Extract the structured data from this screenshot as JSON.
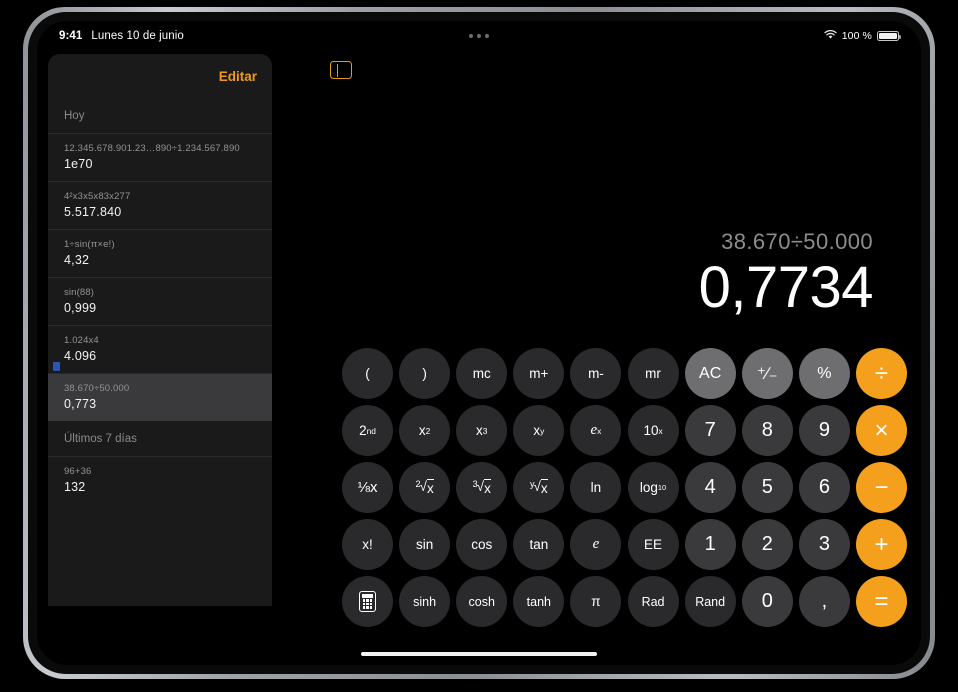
{
  "status_bar": {
    "time": "9:41",
    "date": "Lunes 10 de junio",
    "battery_percent": "100 %",
    "wifi_icon": "wifi-icon",
    "battery_icon": "battery-icon",
    "multitask_icon": "multitask-ellipsis-icon"
  },
  "sidebar": {
    "edit_label": "Editar",
    "toggle_icon": "sidebar-toggle-icon",
    "sections": [
      {
        "title": "Hoy",
        "items": [
          {
            "expression": "12.345.678.901.23…890÷1.234.567.890",
            "result": "1e70",
            "selected": false
          },
          {
            "expression": "4²x3x5x83x277",
            "result": "5.517.840",
            "selected": false
          },
          {
            "expression": "1÷sin(π×e!)",
            "result": "4,32",
            "selected": false
          },
          {
            "expression": "sin(88)",
            "result": "0,999",
            "selected": false
          },
          {
            "expression": "1.024x4",
            "result": "4.096",
            "selected": false
          },
          {
            "expression": "38.670÷50.000",
            "result": "0,773",
            "selected": true
          }
        ]
      },
      {
        "title": "Últimos 7 días",
        "items": [
          {
            "expression": "96+36",
            "result": "132",
            "selected": false
          }
        ]
      }
    ]
  },
  "display": {
    "expression": "38.670÷50.000",
    "result": "0,7734"
  },
  "colors": {
    "accent": "#f5a01c",
    "edit_orange": "#f09a1b",
    "key_function": "#2a2a2c",
    "key_number": "#3a3a3c",
    "key_utility": "#6e6e70",
    "selected_row": "#3a3a3c"
  },
  "keypad": {
    "rows": [
      [
        {
          "label": "(",
          "type": "func",
          "name": "key-open-paren"
        },
        {
          "label": ")",
          "type": "func",
          "name": "key-close-paren"
        },
        {
          "label": "mc",
          "type": "func",
          "name": "key-memory-clear"
        },
        {
          "label": "m+",
          "type": "func",
          "name": "key-memory-add"
        },
        {
          "label": "m-",
          "type": "func",
          "name": "key-memory-subtract"
        },
        {
          "label": "mr",
          "type": "func",
          "name": "key-memory-recall"
        },
        {
          "label": "AC",
          "type": "util",
          "name": "key-all-clear"
        },
        {
          "label": "⁺∕₋",
          "type": "util",
          "name": "key-plus-minus"
        },
        {
          "label": "%",
          "type": "util",
          "name": "key-percent"
        },
        {
          "label": "÷",
          "type": "op",
          "name": "key-divide"
        }
      ],
      [
        {
          "label": "2nd",
          "type": "func",
          "name": "key-second-function"
        },
        {
          "label": "x2",
          "type": "func",
          "name": "key-x-squared"
        },
        {
          "label": "x3",
          "type": "func",
          "name": "key-x-cubed"
        },
        {
          "label": "xy",
          "type": "func",
          "name": "key-x-to-y"
        },
        {
          "label": "ex",
          "type": "func",
          "name": "key-e-to-x"
        },
        {
          "label": "10x",
          "type": "func",
          "name": "key-ten-to-x"
        },
        {
          "label": "7",
          "type": "num",
          "name": "key-7"
        },
        {
          "label": "8",
          "type": "num",
          "name": "key-8"
        },
        {
          "label": "9",
          "type": "num",
          "name": "key-9"
        },
        {
          "label": "×",
          "type": "op",
          "name": "key-multiply"
        }
      ],
      [
        {
          "label": "1/x",
          "type": "func",
          "name": "key-reciprocal"
        },
        {
          "label": "sqrt2",
          "type": "func",
          "name": "key-square-root"
        },
        {
          "label": "sqrt3",
          "type": "func",
          "name": "key-cube-root"
        },
        {
          "label": "sqrty",
          "type": "func",
          "name": "key-y-root"
        },
        {
          "label": "ln",
          "type": "func",
          "name": "key-natural-log"
        },
        {
          "label": "log10",
          "type": "func",
          "name": "key-log-base-10"
        },
        {
          "label": "4",
          "type": "num",
          "name": "key-4"
        },
        {
          "label": "5",
          "type": "num",
          "name": "key-5"
        },
        {
          "label": "6",
          "type": "num",
          "name": "key-6"
        },
        {
          "label": "−",
          "type": "op",
          "name": "key-subtract"
        }
      ],
      [
        {
          "label": "x!",
          "type": "func",
          "name": "key-factorial"
        },
        {
          "label": "sin",
          "type": "func",
          "name": "key-sin"
        },
        {
          "label": "cos",
          "type": "func",
          "name": "key-cos"
        },
        {
          "label": "tan",
          "type": "func",
          "name": "key-tan"
        },
        {
          "label": "e",
          "type": "func",
          "name": "key-euler-e"
        },
        {
          "label": "EE",
          "type": "func",
          "name": "key-exponent-ee"
        },
        {
          "label": "1",
          "type": "num",
          "name": "key-1"
        },
        {
          "label": "2",
          "type": "num",
          "name": "key-2"
        },
        {
          "label": "3",
          "type": "num",
          "name": "key-3"
        },
        {
          "label": "+",
          "type": "op",
          "name": "key-add"
        }
      ],
      [
        {
          "label": "calc",
          "type": "func",
          "name": "key-calculator-mode"
        },
        {
          "label": "sinh",
          "type": "func",
          "name": "key-sinh"
        },
        {
          "label": "cosh",
          "type": "func",
          "name": "key-cosh"
        },
        {
          "label": "tanh",
          "type": "func",
          "name": "key-tanh"
        },
        {
          "label": "π",
          "type": "func",
          "name": "key-pi"
        },
        {
          "label": "Rad",
          "type": "func",
          "name": "key-radians"
        },
        {
          "label": "Rand",
          "type": "func",
          "name": "key-random"
        },
        {
          "label": "0",
          "type": "num",
          "name": "key-0"
        },
        {
          "label": ",",
          "type": "num",
          "name": "key-decimal-comma"
        },
        {
          "label": "=",
          "type": "op",
          "name": "key-equals"
        }
      ]
    ]
  }
}
